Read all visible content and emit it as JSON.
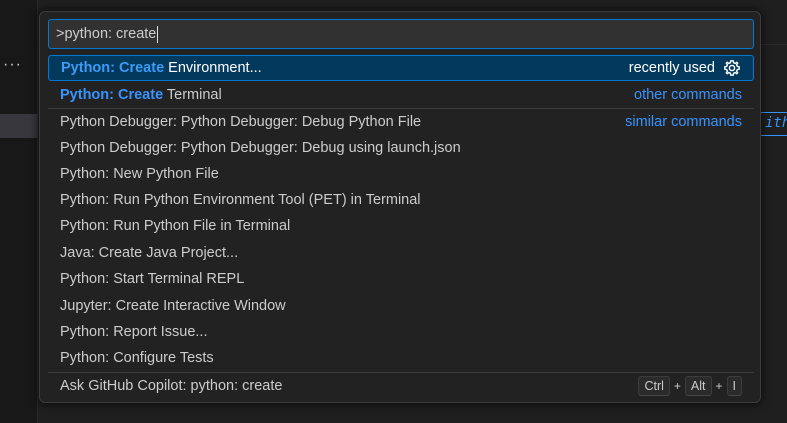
{
  "editor": {
    "more_actions": "···",
    "code_fragment": "ith"
  },
  "input": {
    "value": ">python: create"
  },
  "commands": [
    {
      "highlight": "Python: Create",
      "rest": " Environment...",
      "right_label": "recently used",
      "selected": true
    },
    {
      "highlight": "Python: Create",
      "rest": " Terminal",
      "right_label": "other commands"
    },
    {
      "label": "Python Debugger: Python Debugger: Debug Python File",
      "right_label": "similar commands"
    },
    {
      "label": "Python Debugger: Python Debugger: Debug using launch.json"
    },
    {
      "label": "Python: New Python File"
    },
    {
      "label": "Python: Run Python Environment Tool (PET) in Terminal"
    },
    {
      "label": "Python: Run Python File in Terminal"
    },
    {
      "label": "Java: Create Java Project..."
    },
    {
      "label": "Python: Start Terminal REPL"
    },
    {
      "label": "Jupyter: Create Interactive Window"
    },
    {
      "label": "Python: Report Issue..."
    },
    {
      "label": "Python: Configure Tests"
    }
  ],
  "copilot": {
    "label": "Ask GitHub Copilot: python: create",
    "keys": [
      "Ctrl",
      "Alt",
      "I"
    ],
    "plus": "+"
  },
  "icons": {
    "configure_keybinding": "gear-icon"
  },
  "colors": {
    "accent": "#0078d4",
    "highlight": "#3794ff",
    "selected_bg": "#04395e"
  }
}
